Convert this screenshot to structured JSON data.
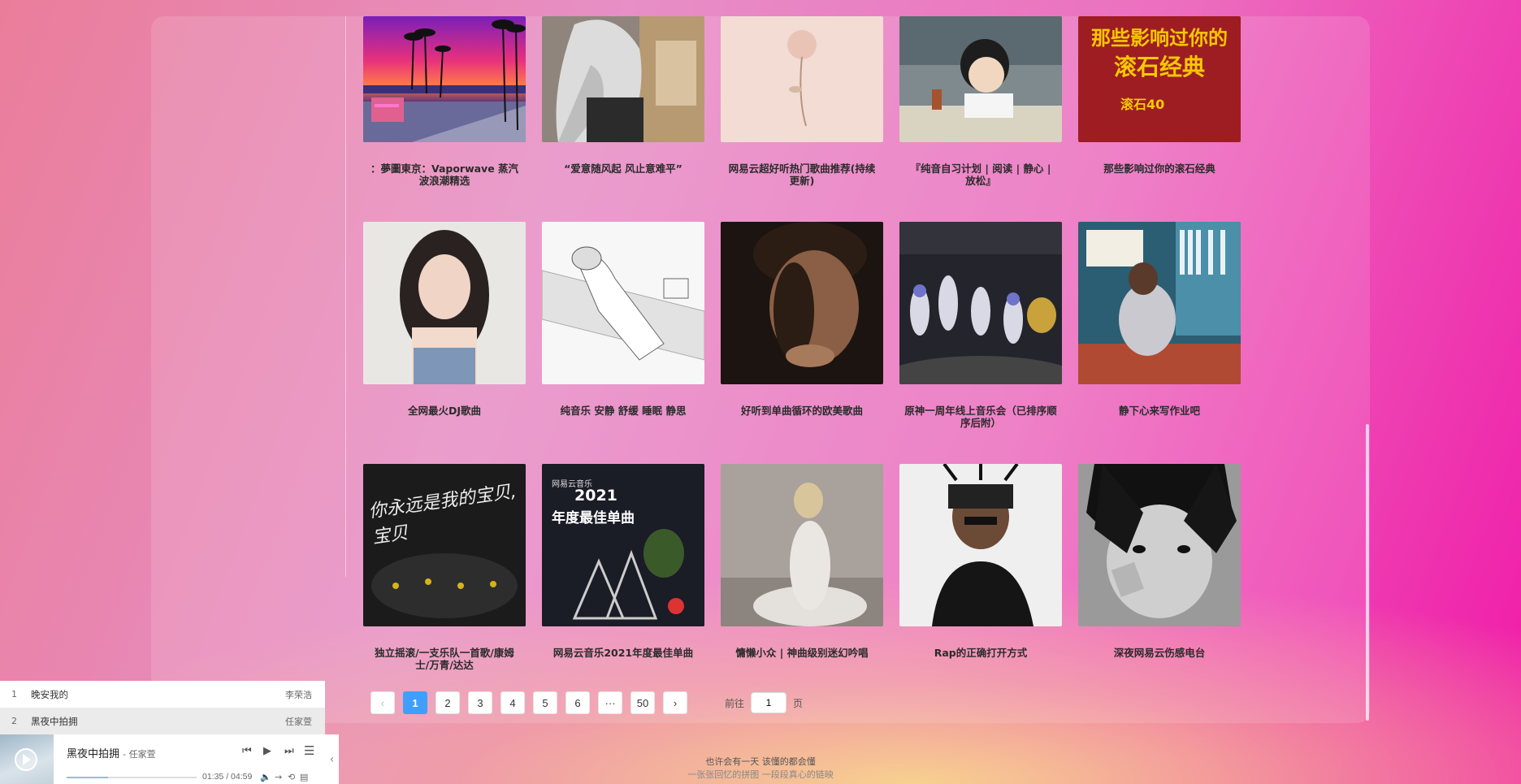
{
  "playlists": [
    {
      "title": "：夢圖東京：Vaporwave 蒸汽波浪潮精选",
      "art": "vaporwave"
    },
    {
      "title": "“爱意随风起 风止意难平”",
      "art": "anime-girl"
    },
    {
      "title": "网易云超好听热门歌曲推荐(持续更新)",
      "art": "flower"
    },
    {
      "title": "『纯音自习计划 | 阅读 | 静心 | 放松』",
      "art": "ghibli"
    },
    {
      "title": "那些影响过你的滚石经典",
      "art": "rock"
    },
    {
      "title": "全网最火DJ歌曲",
      "art": "portrait"
    },
    {
      "title": "纯音乐 安静 舒缓 睡眠 静思",
      "art": "sketch"
    },
    {
      "title": "好听到单曲循环的欧美歌曲",
      "art": "man"
    },
    {
      "title": "原神一周年线上音乐会（已排序顺序后附）",
      "art": "genshin"
    },
    {
      "title": "静下心来写作业吧",
      "art": "study"
    },
    {
      "title": "独立摇滚/一支乐队一首歌/康姆士/万青/达达",
      "art": "concert"
    },
    {
      "title": "网易云音乐2021年度最佳单曲",
      "art": "best2021"
    },
    {
      "title": "慵懒小众 | 神曲级别迷幻吟唱",
      "art": "dress"
    },
    {
      "title": "Rap的正确打开方式",
      "art": "rap"
    },
    {
      "title": "深夜网易云伤感电台",
      "art": "manga"
    }
  ],
  "cover_text": {
    "rock_line1": "那些影响过你的",
    "rock_line2": "滚石经典",
    "rock_badge": "滚石40",
    "best_brand": "网易云音乐",
    "best_year": "2021",
    "best_sub": "年度最佳单曲",
    "concert_text": "你永远是我的宝贝,宝贝"
  },
  "pagination": {
    "prev": "‹",
    "pages": [
      "1",
      "2",
      "3",
      "4",
      "5",
      "6",
      "···",
      "50"
    ],
    "active": "1",
    "next": "›",
    "goto_prefix": "前往",
    "goto_value": "1",
    "goto_suffix": "页"
  },
  "footer": {
    "line1": "也许会有一天 该懂的都会懂",
    "line2": "一张张回忆的拼图 一段段真心的链映"
  },
  "player": {
    "queue": [
      {
        "num": "1",
        "name": "晚安我的",
        "artist": "李荣浩"
      },
      {
        "num": "2",
        "name": "黑夜中拍拥",
        "artist": "任家萱"
      }
    ],
    "song": "黑夜中拍拥",
    "artist": "任家萱",
    "time": "01:35 / 04:59",
    "progress": 0.32,
    "collapse": "‹"
  },
  "colors": {
    "accent": "#409eff",
    "bg_left": "#ea7d9a",
    "bg_right": "#f01aa8"
  }
}
